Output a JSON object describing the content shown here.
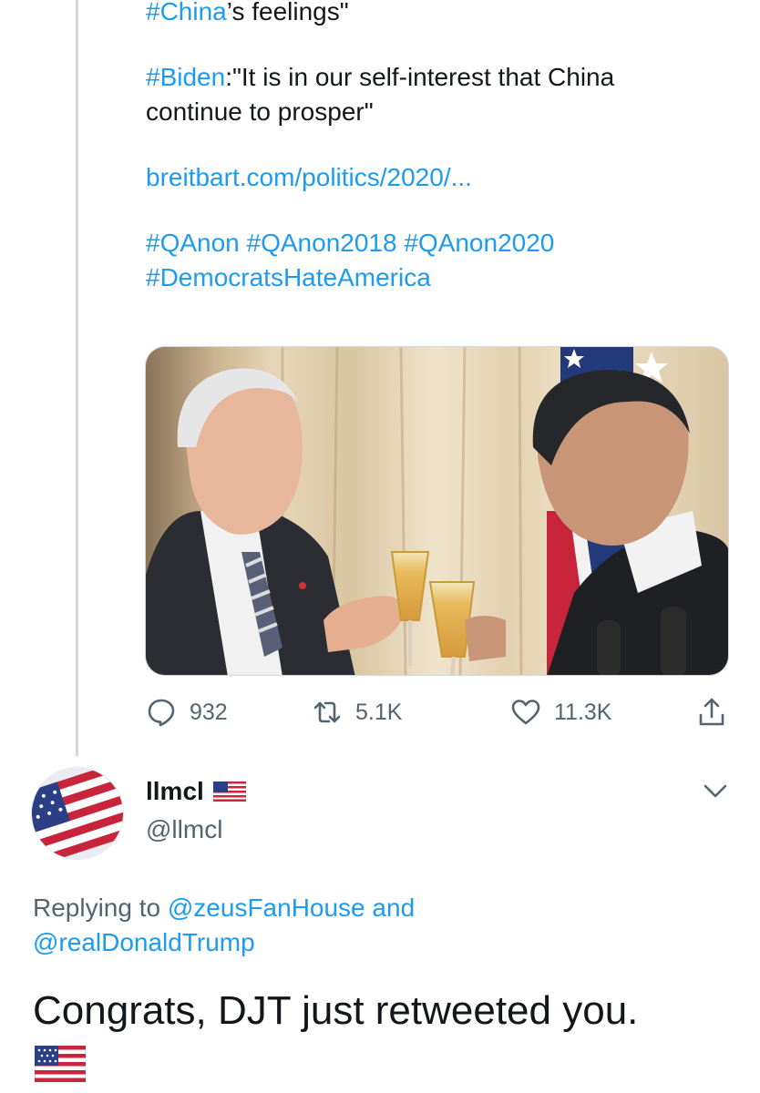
{
  "tweet": {
    "line1_tag": "#China",
    "line1_rest": "’s feelings\"",
    "line2_tag": "#Biden",
    "line2_rest": ":\"It is in our self-interest that China",
    "line3": "continue to prosper\"",
    "link": "breitbart.com/politics/2020/...",
    "hashtags_line1": "#QAnon #QAnon2018 #QAnon2020",
    "hashtags_line2": "#DemocratsHateAmerica",
    "photo_icon": "photo-toast-two-men",
    "actions": {
      "reply_count": "932",
      "retweet_count": "5.1K",
      "like_count": "11.3K"
    }
  },
  "reply": {
    "display_name": "llmcl",
    "handle": "@llmcl",
    "replying_prefix": "Replying to",
    "mention_1": "@zeusFanHouse",
    "and_word": "and",
    "mention_2": "@realDonaldTrump",
    "text": "Congrats, DJT just retweeted you.",
    "flag_icon": "us-flag-emoji"
  },
  "colors": {
    "link": "#1d9bf0",
    "secondary_text": "#536471",
    "primary_text": "#14171a",
    "divider": "#cfd9de"
  }
}
